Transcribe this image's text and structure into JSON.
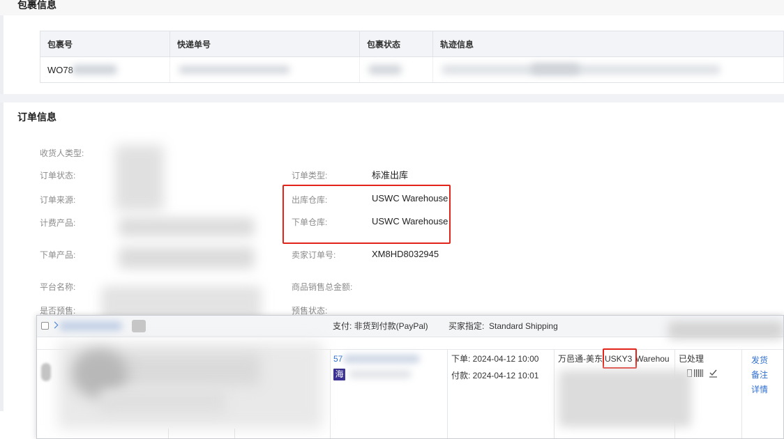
{
  "package_section": {
    "title": "包裹信息",
    "table": {
      "headers": [
        "包裹号",
        "快递单号",
        "包裹状态",
        "轨迹信息"
      ],
      "rows": [
        {
          "package_no": "WO78"
        }
      ]
    }
  },
  "order_section": {
    "title": "订单信息",
    "left_labels": [
      "收货人类型:",
      "订单状态:",
      "订单来源:",
      "计费产品:",
      "下单产品:",
      "平台名称:",
      "是否预售:"
    ],
    "right_fields": [
      {
        "label": "订单类型:",
        "value": "标准出库"
      },
      {
        "label": "出库仓库:",
        "value": "USWC Warehouse"
      },
      {
        "label": "下单仓库:",
        "value": "USWC Warehouse"
      },
      {
        "label": "卖家订单号:",
        "value": "XM8HD8032945"
      },
      {
        "label": "商品销售总金额:"
      },
      {
        "label": "预售状态:"
      }
    ]
  },
  "order_list": {
    "header": {
      "payment": "支付: 非货到付款(PayPal)",
      "buyer_shipping": "买家指定:  Standard Shipping"
    },
    "row": {
      "order_no_prefix": "57",
      "channel_badge": "海",
      "placed_time": "下单: 2024-04-12 10:00",
      "paid_time": "付款: 2024-04-12 10:01",
      "warehouse_prefix": "万邑通-美东",
      "warehouse_code": "USKY3",
      "warehouse_suffix": "Warehou",
      "status": "已处理",
      "actions": [
        "发货",
        "备注",
        "详情"
      ]
    }
  },
  "icons": {
    "select": "checkbox-icon",
    "expand": "chevron-right-icon",
    "tag": "tag-icon",
    "print": "print-icon",
    "barcode": "barcode-icon",
    "sign": "signature-icon"
  },
  "colors": {
    "link": "#2f6fd0",
    "highlight_border": "#e2231a",
    "badge_bg": "#3a3192",
    "table_header_bg": "#f2f4f7",
    "border": "#dfe3e8",
    "label_text": "#8c8c8c",
    "body_text": "#222222"
  }
}
